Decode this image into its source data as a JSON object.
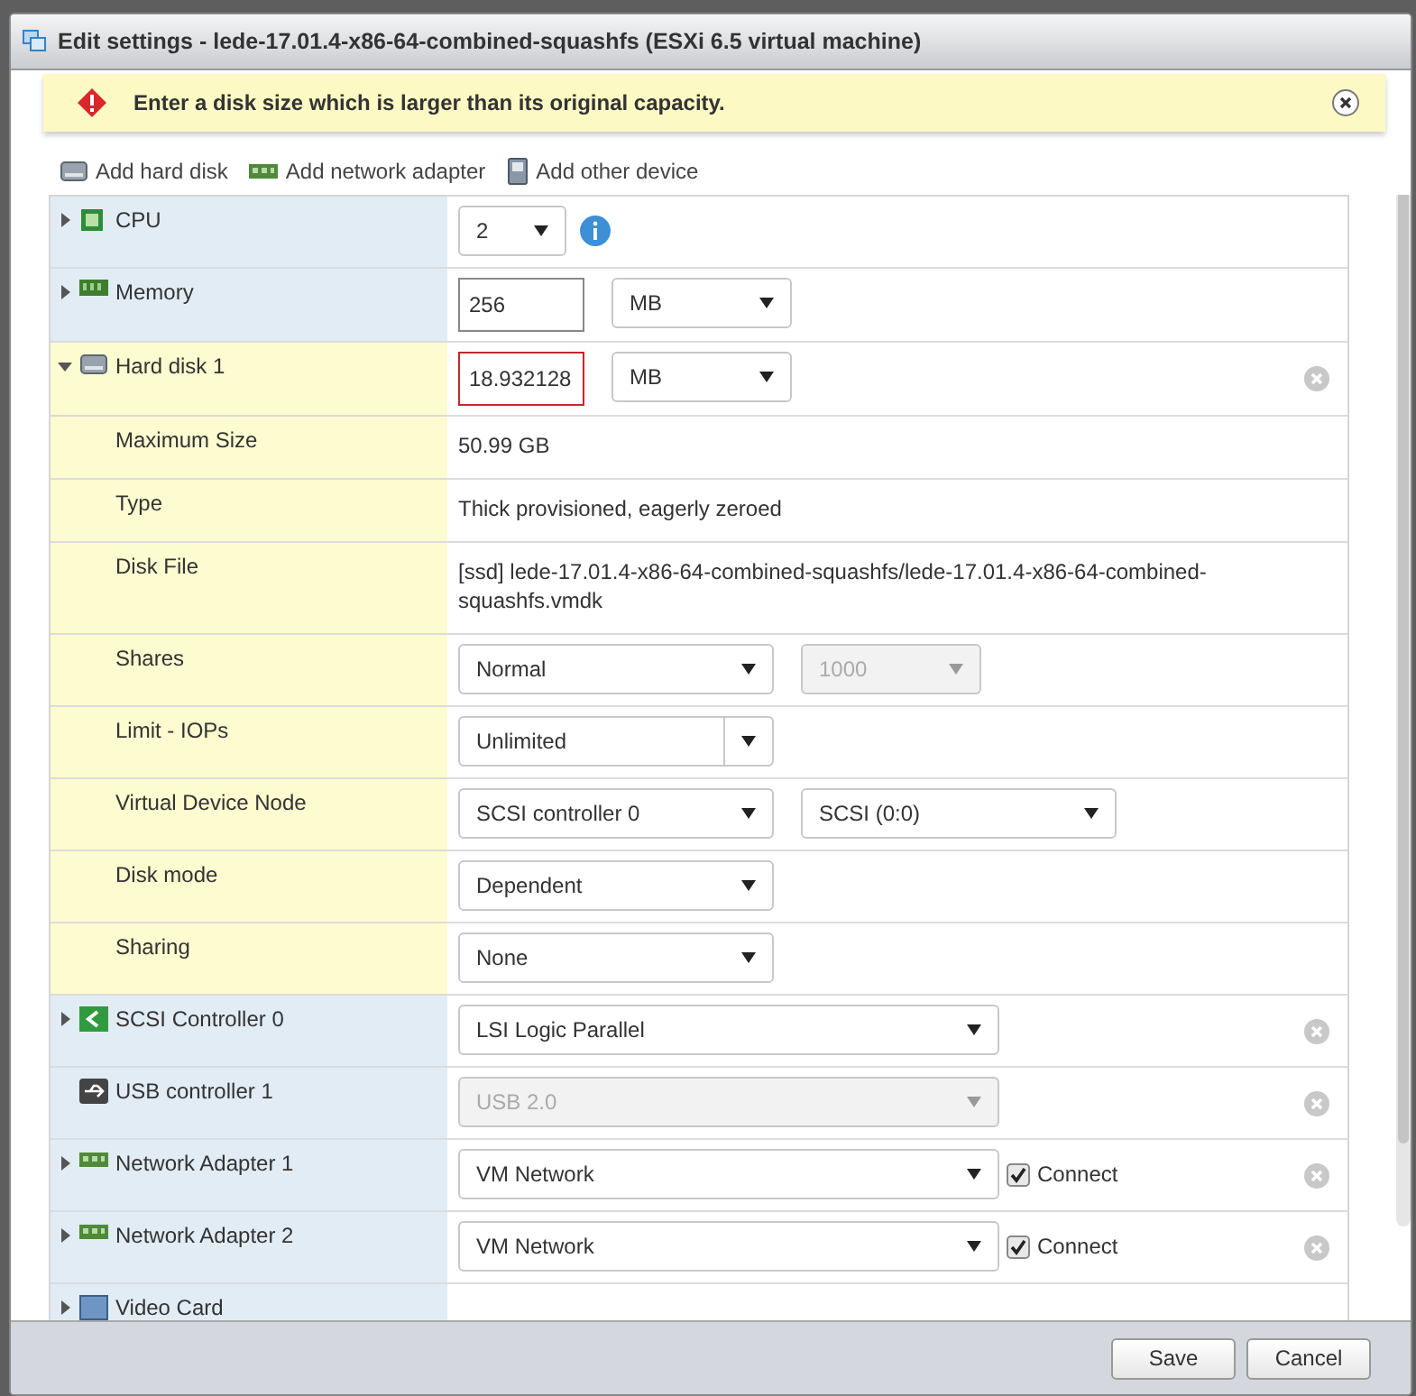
{
  "window": {
    "title": "Edit settings - lede-17.01.4-x86-64-combined-squashfs (ESXi 6.5 virtual machine)"
  },
  "alert": {
    "message": "Enter a disk size which is larger than its original capacity."
  },
  "toolbar": [
    {
      "label": "Add hard disk",
      "kind": "disk"
    },
    {
      "label": "Add network adapter",
      "kind": "network"
    },
    {
      "label": "Add other device",
      "kind": "device"
    }
  ],
  "devices": [
    {
      "label": "CPU",
      "kind": "cpu",
      "expanded": false,
      "removable": false,
      "controls": [
        {
          "kind": "tiny-select",
          "value": "2",
          "disabled": false
        },
        {
          "kind": "info"
        }
      ]
    },
    {
      "label": "Memory",
      "kind": "memory",
      "expanded": false,
      "removable": false,
      "controls": [
        {
          "kind": "input",
          "value": "256",
          "invalid": false
        },
        {
          "kind": "short-select",
          "value": "MB",
          "disabled": false
        }
      ]
    },
    {
      "label": "Hard disk 1",
      "kind": "disk",
      "expanded": true,
      "removable": true,
      "controls": [
        {
          "kind": "input",
          "value": "18.932128",
          "invalid": true
        },
        {
          "kind": "short-select",
          "value": "MB",
          "disabled": false
        }
      ],
      "children": [
        {
          "label": "Maximum Size",
          "controls": [
            {
              "kind": "text",
              "value": "50.99 GB"
            }
          ]
        },
        {
          "label": "Type",
          "controls": [
            {
              "kind": "text",
              "value": "Thick provisioned, eagerly zeroed"
            }
          ]
        },
        {
          "label": "Disk File",
          "controls": [
            {
              "kind": "text",
              "value": "[ssd] lede-17.01.4-x86-64-combined-squashfs/lede-17.01.4-x86-64-combined-squashfs.vmdk"
            }
          ]
        },
        {
          "label": "Shares",
          "controls": [
            {
              "kind": "select",
              "value": "Normal",
              "disabled": false
            },
            {
              "kind": "short-select",
              "value": "1000",
              "disabled": true
            }
          ]
        },
        {
          "label": "Limit - IOPs",
          "controls": [
            {
              "kind": "combo",
              "value": "Unlimited",
              "disabled": false
            }
          ]
        },
        {
          "label": "Virtual Device Node",
          "controls": [
            {
              "kind": "select",
              "value": "SCSI controller 0",
              "disabled": false
            },
            {
              "kind": "select",
              "value": "SCSI (0:0)",
              "disabled": false
            }
          ]
        },
        {
          "label": "Disk mode",
          "controls": [
            {
              "kind": "select",
              "value": "Dependent",
              "disabled": false
            }
          ]
        },
        {
          "label": "Sharing",
          "controls": [
            {
              "kind": "select",
              "value": "None",
              "disabled": false
            }
          ]
        }
      ]
    },
    {
      "label": "SCSI Controller 0",
      "kind": "scsi",
      "expanded": false,
      "removable": true,
      "controls": [
        {
          "kind": "wide-select",
          "value": "LSI Logic Parallel",
          "disabled": false
        }
      ]
    },
    {
      "label": "USB controller 1",
      "kind": "usb",
      "removable": true,
      "controls": [
        {
          "kind": "wide-select",
          "value": "USB 2.0",
          "disabled": true
        }
      ]
    },
    {
      "label": "Network Adapter 1",
      "kind": "network",
      "expanded": false,
      "removable": true,
      "controls": [
        {
          "kind": "wide-select",
          "value": "VM Network",
          "disabled": false
        },
        {
          "kind": "checkbox",
          "label": "Connect",
          "checked": true
        }
      ]
    },
    {
      "label": "Network Adapter 2",
      "kind": "network",
      "expanded": false,
      "removable": true,
      "controls": [
        {
          "kind": "wide-select",
          "value": "VM Network",
          "disabled": false
        },
        {
          "kind": "checkbox",
          "label": "Connect",
          "checked": true
        }
      ]
    },
    {
      "label": "Video Card",
      "kind": "video",
      "expanded": false,
      "removable": false
    }
  ],
  "buttons": [
    {
      "label": "Save"
    },
    {
      "label": "Cancel"
    }
  ]
}
